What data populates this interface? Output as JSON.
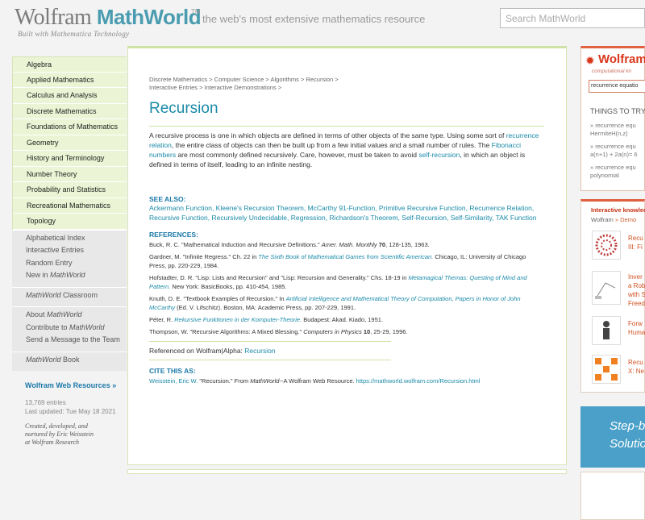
{
  "header": {
    "logo_wolfram": "Wolfram ",
    "logo_math": "MathWorld",
    "logo_tm": "TM",
    "logo_sub": "Built with Mathematica Technology",
    "tagline": "the web's most extensive mathematics resource",
    "search_placeholder": "Search MathWorld"
  },
  "sidebar": {
    "topics": [
      "Algebra",
      "Applied Mathematics",
      "Calculus and Analysis",
      "Discrete Mathematics",
      "Foundations of Mathematics",
      "Geometry",
      "History and Terminology",
      "Number Theory",
      "Probability and Statistics",
      "Recreational Mathematics",
      "Topology"
    ],
    "links": [
      "Alphabetical Index",
      "Interactive Entries",
      "Random Entry"
    ],
    "new_prefix": "New in ",
    "new_mw": "MathWorld",
    "classroom_mw": "MathWorld",
    "classroom_rest": " Classroom",
    "about_prefix": "About ",
    "about_mw": "MathWorld",
    "contribute_prefix": "Contribute to ",
    "contribute_mw": "MathWorld",
    "send_message": "Send a Message to the Team",
    "book_mw": "MathWorld",
    "book_rest": " Book",
    "wr_title": "Wolfram Web Resources »",
    "entries": "13,769 entries",
    "updated": "Last updated: Tue May 18 2021",
    "credit1": "Created, developed, and",
    "credit2": "nurtured by Eric Weisstein",
    "credit3": "at Wolfram Research"
  },
  "main": {
    "breadcrumb1": "Discrete Mathematics > Computer Science > Algorithms > Recursion >",
    "breadcrumb2": "Interactive Entries > Interactive Demonstrations >",
    "title": "Recursion",
    "p1a": "A recursive process is one in which objects are defined in terms of other objects of the same type. Using some sort of ",
    "p1_link1": "recurrence relation",
    "p1b": ", the entire class of objects can then be built up from a few initial values and a small number of rules. The ",
    "p1_link2": "Fibonacci numbers",
    "p1c": " are most commonly defined recursively. Care, however, must be taken to avoid ",
    "p1_link3": "self-recursion",
    "p1d": ", in which an object is defined in terms of itself, leading to an infinite nesting.",
    "see_also_head": "SEE ALSO:",
    "see_also": "Ackermann Function, Kleene's Recursion Theorem, McCarthy 91-Function, Primitive Recursive Function, Recurrence Relation, Recursive Function, Recursively Undecidable, Regression, Richardson's Theorem, Self-Recursion, Self-Similarity, TAK Function",
    "references_head": "REFERENCES:",
    "ref1a": "Buck, R. C. \"Mathematical Induction and Recursive Definitions.\" ",
    "ref1b": "Amer. Math. Monthly",
    "ref1c": "70",
    "ref1d": ", 128-135, 1963.",
    "ref2a": "Gardner, M. \"Infinite Regress.\" Ch. 22 in ",
    "ref2b": "The Sixth Book of Mathematical Games from Scientific American.",
    "ref2c": " Chicago, IL: University of Chicago Press, pp. 220-229, 1984.",
    "ref3a": "Hofstadter, D. R. \"Lisp: Lists and Recursion\" and \"Lisp: Recursion and Generality.\" Chs. 18-19 in ",
    "ref3b": "Metamagical Themas: Questing of Mind and Pattern.",
    "ref3c": " New York: BasicBooks, pp. 410-454, 1985.",
    "ref4a": "Knuth, D. E. \"Textbook Examples of Recursion.\" In ",
    "ref4b": "Artificial Intelligence and Mathematical Theory of Computation, Papers in Honor of John McCarthy",
    "ref4c": " (Ed. V. Lifschitz). Boston, MA: Academic Press, pp. 207-229, 1991.",
    "ref5a": "Péter, R. ",
    "ref5b": "Rekursive Funktionen in der Komputer-Theorie.",
    "ref5c": " Budapest: Akad. Kiado, 1951.",
    "ref6a": "Thompson, W. \"Recursive Algorithms: A Mixed Blessing.\" ",
    "ref6b": "Computers in Physics",
    "ref6c": "10",
    "ref6d": ", 25-29, 1996.",
    "alpha_prefix": "Referenced on Wolfram|Alpha: ",
    "alpha_link": "Recursion",
    "cite_head": "CITE THIS AS:",
    "cite_author": "Weisstein, Eric W.",
    "cite_a": " \"Recursion.\" From ",
    "cite_mw": "MathWorld",
    "cite_b": "--A Wolfram Web Resource. ",
    "cite_url": "https://mathworld.wolfram.com/Recursion.html"
  },
  "right": {
    "wa_logo": "Wolfram",
    "wa_star": "✹",
    "wa_sub": "computational kn",
    "wa_input": "recurrence equatio",
    "things": "THINGS TO TRY:",
    "ex1a": "» recurrence equ",
    "ex1b": "HermiteH(n,z)",
    "ex2a": "» recurrence equ",
    "ex2b": "a(n+1) + 2a(n)= 6",
    "ex3a": "» recurrence equ",
    "ex3b": "polynomial",
    "ik_title": "Interactive knowled",
    "ik_sub_a": "Wolfram ",
    "ik_sub_b": "» Demo",
    "t1a": "Recu",
    "t1b": "III: Fi",
    "t2a": "Inver",
    "t2b": "a Rob",
    "t2c": "with S",
    "t2d": "Freed",
    "t3a": "Forw",
    "t3b": "Huma",
    "t4a": "Recu",
    "t4b": "X: Ne",
    "step_a": "Step-b",
    "step_b": "Solutio"
  }
}
